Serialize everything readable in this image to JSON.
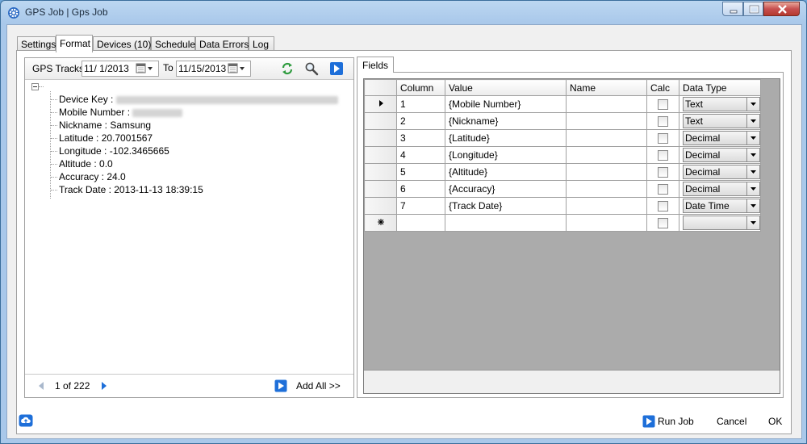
{
  "window": {
    "title": "GPS Job | Gps Job"
  },
  "tabs": [
    {
      "label": "Settings"
    },
    {
      "label": "Format"
    },
    {
      "label": "Devices (10)"
    },
    {
      "label": "Schedule"
    },
    {
      "label": "Data Errors"
    },
    {
      "label": "Log"
    }
  ],
  "left": {
    "toolbar": {
      "label": "GPS Tracks",
      "from_date": "11/  1/2013",
      "to_label": "To",
      "to_date": "11/15/2013"
    },
    "tree": [
      {
        "label": "Device Key : ",
        "value": "",
        "blurred": true
      },
      {
        "label": "Mobile Number : ",
        "value": "",
        "blurred": true
      },
      {
        "label": "Nickname : Samsung"
      },
      {
        "label": "Latitude : 20.7001567"
      },
      {
        "label": "Longitude : -102.3465665"
      },
      {
        "label": "Altitude : 0.0"
      },
      {
        "label": "Accuracy : 24.0"
      },
      {
        "label": "Track Date : 2013-11-13 18:39:15"
      }
    ],
    "footer": {
      "pager": "1 of 222",
      "add_all": "Add All >>"
    }
  },
  "right": {
    "tab": "Fields",
    "columns": [
      "Column",
      "Value",
      "Name",
      "Calc",
      "Data Type"
    ],
    "rows": [
      {
        "column": "1",
        "value": "{Mobile Number}",
        "name": "",
        "type": "Text"
      },
      {
        "column": "2",
        "value": "{Nickname}",
        "name": "",
        "type": "Text"
      },
      {
        "column": "3",
        "value": "{Latitude}",
        "name": "",
        "type": "Decimal"
      },
      {
        "column": "4",
        "value": "{Longitude}",
        "name": "",
        "type": "Decimal"
      },
      {
        "column": "5",
        "value": "{Altitude}",
        "name": "",
        "type": "Decimal"
      },
      {
        "column": "6",
        "value": "{Accuracy}",
        "name": "",
        "type": "Decimal"
      },
      {
        "column": "7",
        "value": "{Track Date}",
        "name": "",
        "type": "Date Time"
      }
    ]
  },
  "bottom": {
    "run_job": "Run Job",
    "cancel": "Cancel",
    "ok": "OK"
  },
  "colors": {
    "accent": "#1e6fd9",
    "green": "#2e9b3e"
  }
}
